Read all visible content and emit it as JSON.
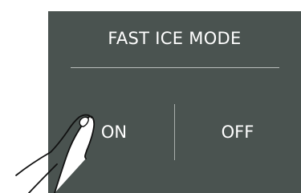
{
  "panel": {
    "title": "FAST ICE MODE",
    "options": [
      {
        "label": "ON"
      },
      {
        "label": "OFF"
      }
    ]
  },
  "colors": {
    "panel_bg": "#4a5350",
    "text": "#ffffff",
    "divider": "#b9bebc"
  },
  "icons": {
    "pointer": "hand-pointer-icon"
  }
}
